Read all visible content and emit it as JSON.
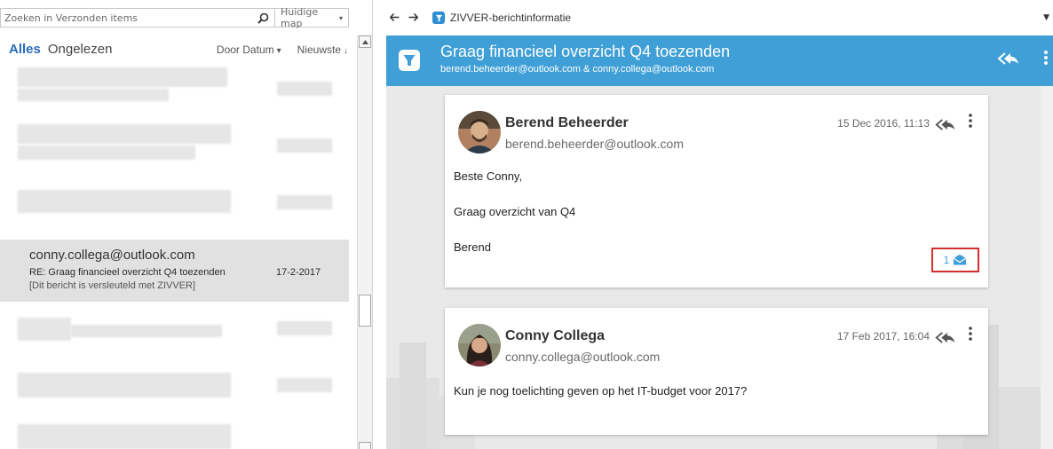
{
  "search": {
    "placeholder": "Zoeken in Verzonden items",
    "scope": "Huidige map"
  },
  "filters": {
    "all": "Alles",
    "unread": "Ongelezen",
    "sort": "Door Datum",
    "order": "Nieuwste"
  },
  "selected_message": {
    "from": "conny.collega@outlook.com",
    "subject": "RE: Graag financieel overzicht Q4 toezenden",
    "date": "17-2-2017",
    "preview": "[Dit bericht is versleuteld met ZIVVER]"
  },
  "reading_pane": {
    "title": "ZIVVER-berichtinformatie",
    "header": {
      "subject": "Graag financieel overzicht Q4 toezenden",
      "parties": "berend.beheerder@outlook.com & conny.collega@outlook.com"
    },
    "messages": [
      {
        "name": "Berend Beheerder",
        "email": "berend.beheerder@outlook.com",
        "date": "15 Dec 2016, 11:13",
        "body": [
          "Beste Conny,",
          "Graag overzicht van Q4",
          "Berend"
        ],
        "read_count": "1"
      },
      {
        "name": "Conny Collega",
        "email": "conny.collega@outlook.com",
        "date": "17 Feb 2017, 16:04",
        "body": [
          "Kun je nog toelichting geven op het IT-budget voor 2017?"
        ]
      }
    ]
  },
  "colors": {
    "accent": "#3f9fd6",
    "link_blue": "#2b6cb8",
    "highlight_red": "#d32f2f"
  }
}
